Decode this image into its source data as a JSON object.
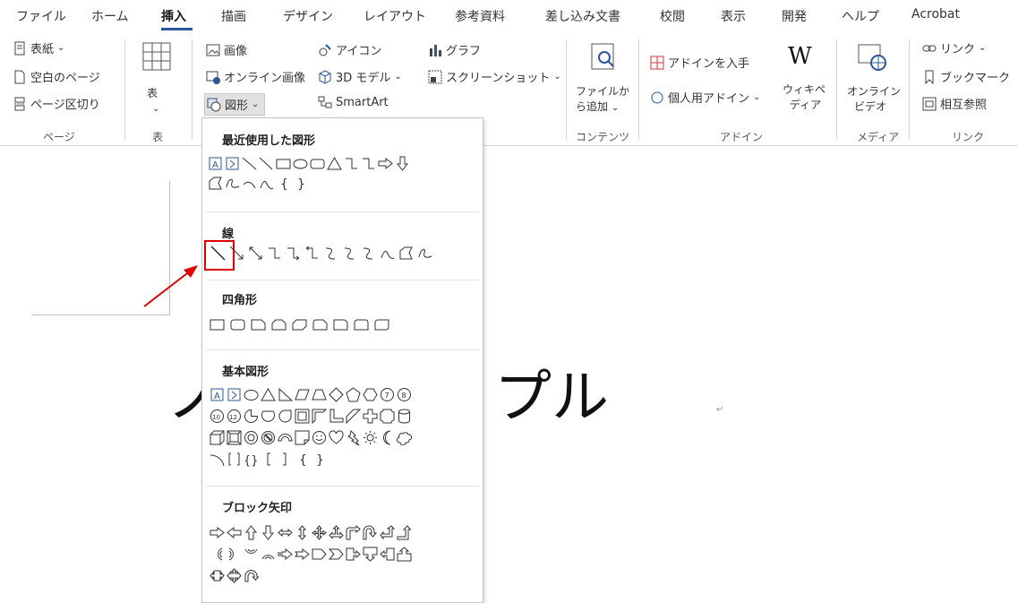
{
  "tabs": [
    "ファイル",
    "ホーム",
    "挿入",
    "描画",
    "デザイン",
    "レイアウト",
    "参考資料",
    "差し込み文書",
    "校閲",
    "表示",
    "開発",
    "ヘルプ",
    "Acrobat"
  ],
  "active_tab": "挿入",
  "ribbon": {
    "pages": {
      "cover": "表紙",
      "blank": "空白のページ",
      "break": "ページ区切り",
      "label": "ページ"
    },
    "table": {
      "button": "表",
      "label": "表"
    },
    "illustrations": {
      "pictures": "画像",
      "online_pictures": "オンライン画像",
      "shapes": "図形",
      "icons": "アイコン",
      "models3d": "3D モデル",
      "smartart": "SmartArt",
      "chart": "グラフ",
      "screenshot": "スクリーンショット"
    },
    "content": {
      "add_from_file_1": "ファイルか",
      "add_from_file_2": "ら追加",
      "label": "コンテンツ"
    },
    "addins": {
      "get": "アドインを入手",
      "personal": "個人用アドイン",
      "wiki_1": "ウィキペ",
      "wiki_2": "ディア",
      "label": "アドイン"
    },
    "media": {
      "online_video_1": "オンライン",
      "online_video_2": "ビデオ",
      "label": "メディア"
    },
    "links": {
      "link": "リンク",
      "bookmark": "ブックマーク",
      "cross_ref": "相互参照",
      "label": "リンク"
    }
  },
  "dropdown": {
    "recent": "最近使用した図形",
    "lines": "線",
    "rectangles": "四角形",
    "basic": "基本図形",
    "block_arrows": "ブロック矢印"
  },
  "document": {
    "text_left": "ノ",
    "text_right": "プル"
  },
  "colors": {
    "accent": "#2b579a",
    "highlight": "#e00000"
  }
}
